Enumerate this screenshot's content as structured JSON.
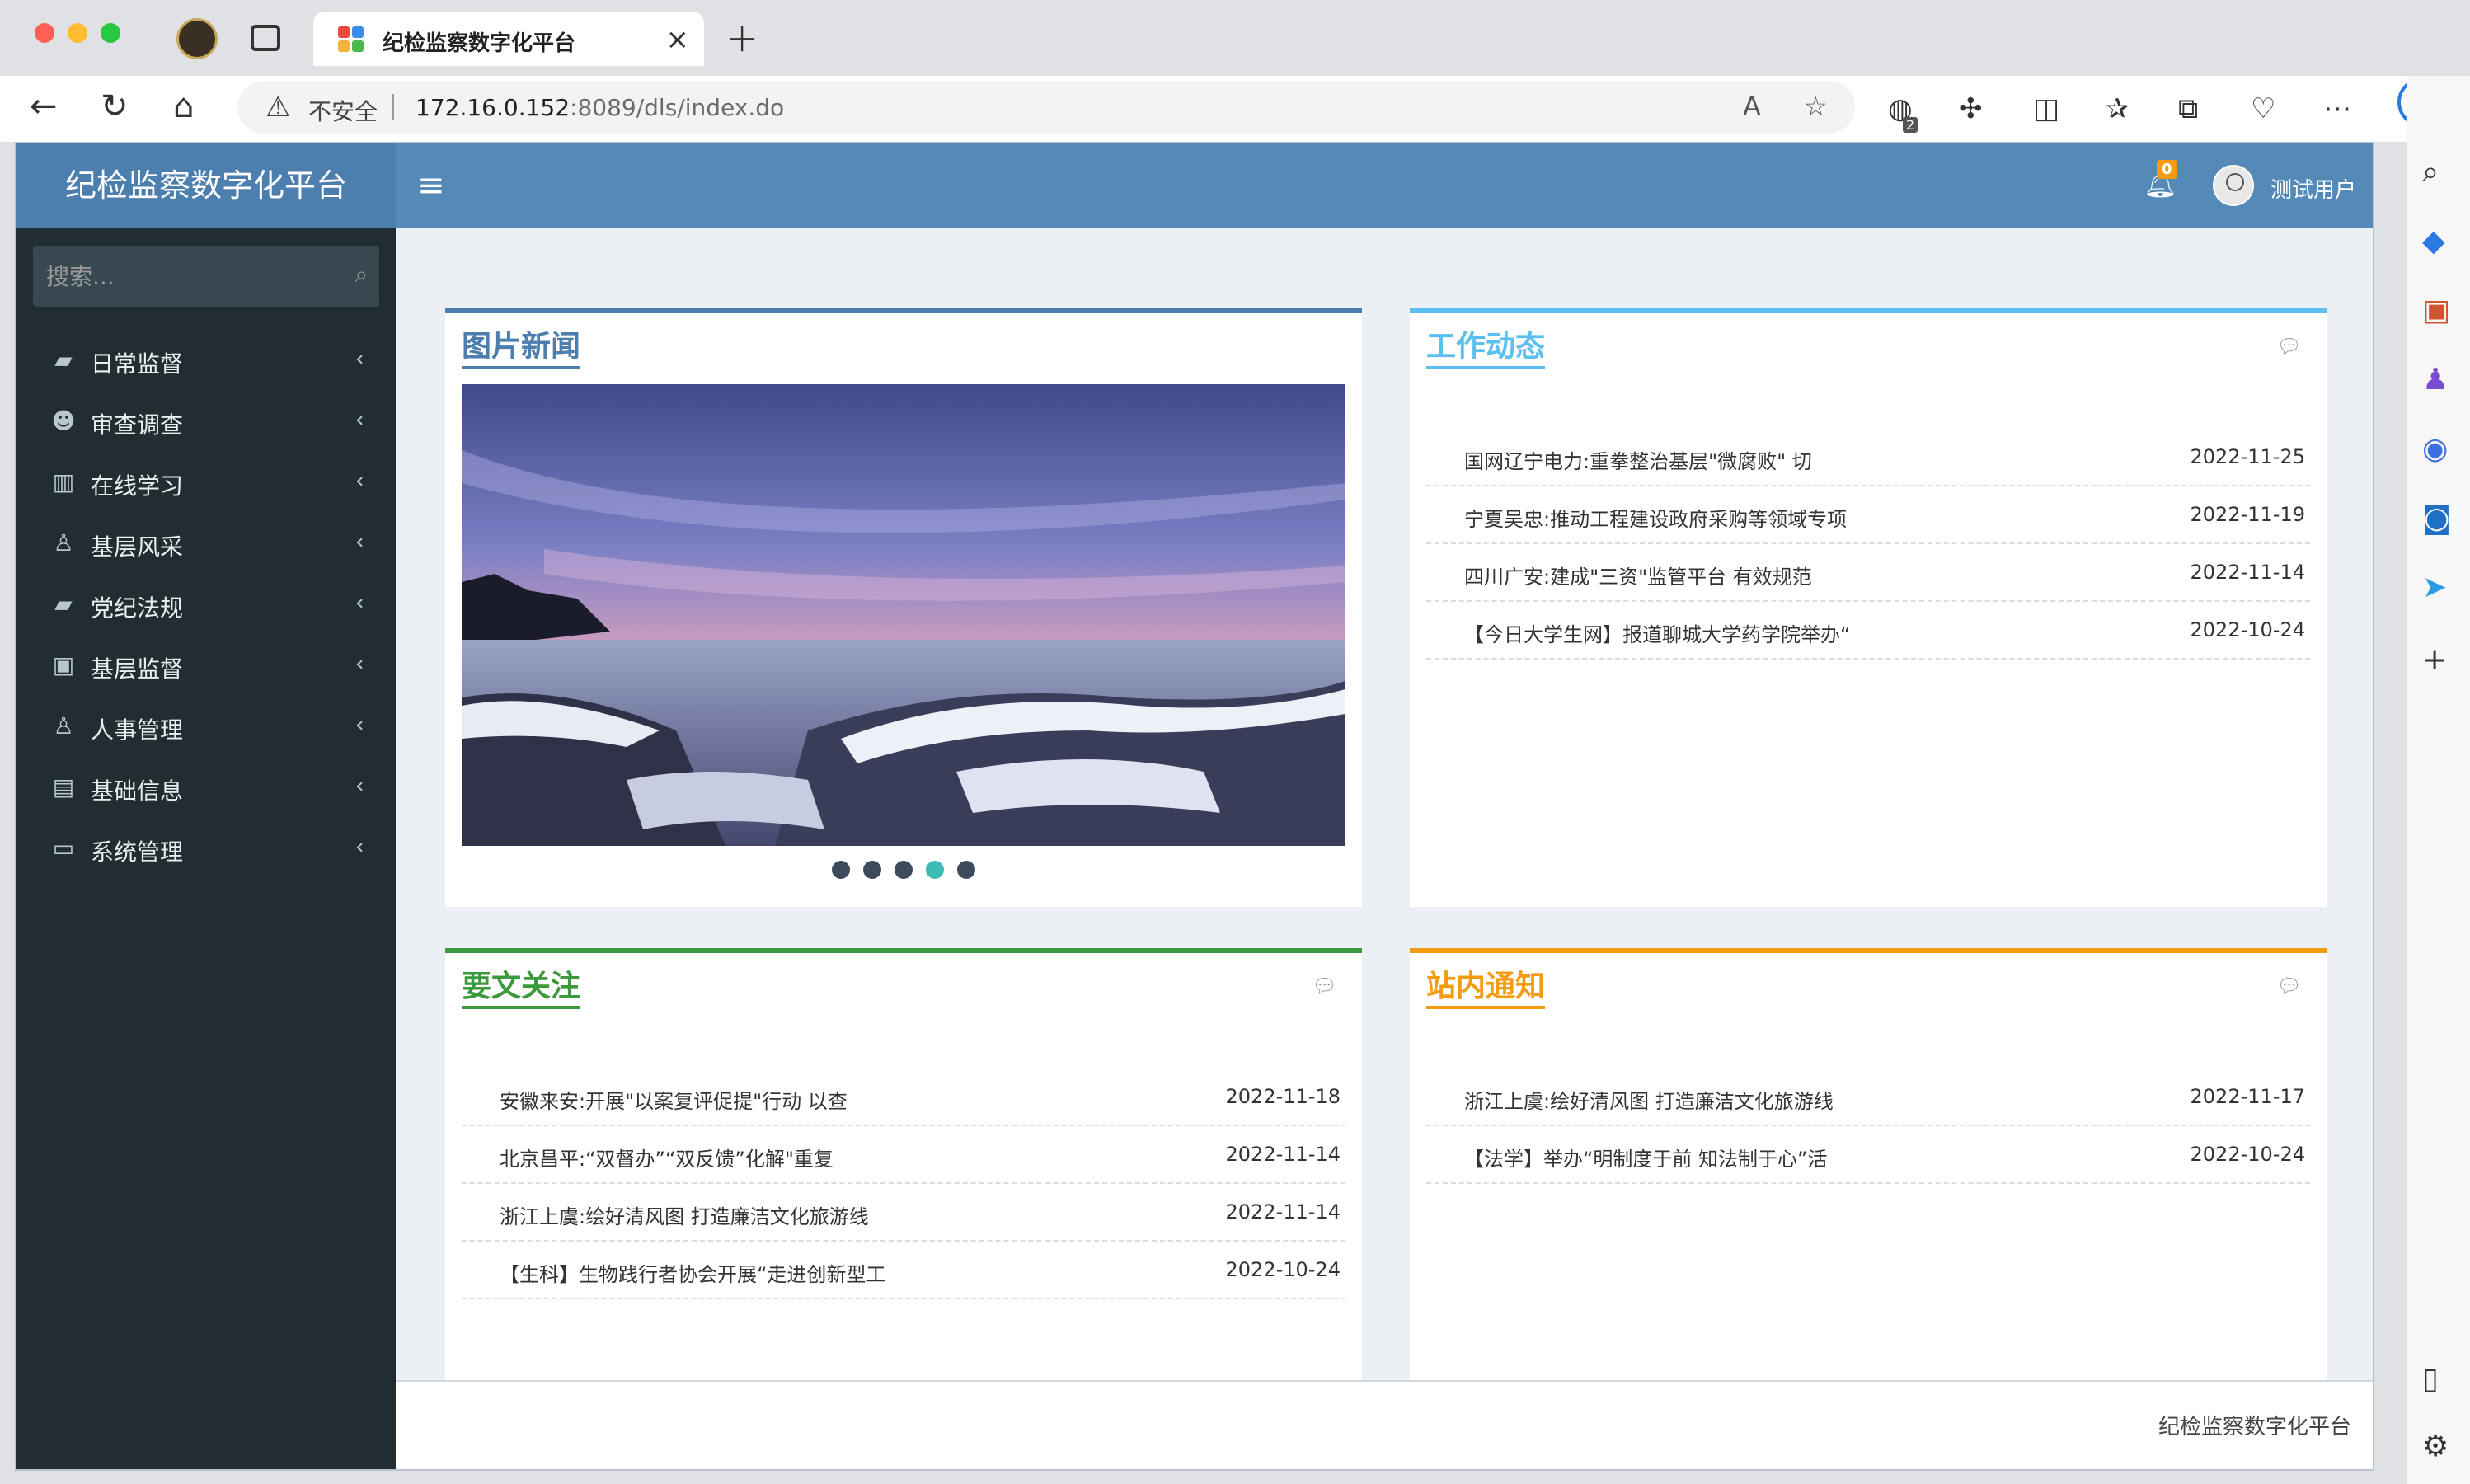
{
  "browser": {
    "tab_title": "纪检监察数字化平台",
    "security_label": "不安全",
    "url_host": "172.16.0.152",
    "url_rest": ":8089/dls/index.do",
    "extension_badge": "2"
  },
  "app": {
    "logo": "纪检监察数字化平台",
    "notification_count": "0",
    "username": "测试用户",
    "search_placeholder": "搜索...",
    "footer": "纪检监察数字化平台"
  },
  "sidebar": {
    "items": [
      {
        "label": "日常监督",
        "icon": "book-icon"
      },
      {
        "label": "审查调查",
        "icon": "users-icon"
      },
      {
        "label": "在线学习",
        "icon": "building-icon"
      },
      {
        "label": "基层风采",
        "icon": "person-icon"
      },
      {
        "label": "党纪法规",
        "icon": "book-icon"
      },
      {
        "label": "基层监督",
        "icon": "contact-book-icon"
      },
      {
        "label": "人事管理",
        "icon": "person-icon"
      },
      {
        "label": "基础信息",
        "icon": "file-icon"
      },
      {
        "label": "系统管理",
        "icon": "desktop-icon"
      }
    ]
  },
  "panels": {
    "photo_news": {
      "title": "图片新闻",
      "slide_count": 5,
      "active_slide": 3,
      "color": "#4d7fae"
    },
    "work_news": {
      "title": "工作动态",
      "color": "#5bc0ef",
      "items": [
        {
          "title": "国网辽宁电力:重拳整治基层\"微腐败\" 切",
          "date": "2022-11-25"
        },
        {
          "title": "宁夏吴忠:推动工程建设政府采购等领域专项",
          "date": "2022-11-19"
        },
        {
          "title": "四川广安:建成\"三资\"监管平台 有效规范",
          "date": "2022-11-14"
        },
        {
          "title": "【今日大学生网】报道聊城大学药学院举办“",
          "date": "2022-10-24"
        }
      ]
    },
    "key_articles": {
      "title": "要文关注",
      "color": "#3c9a3c",
      "items": [
        {
          "title": "安徽来安:开展\"以案复评促提\"行动 以查",
          "date": "2022-11-18"
        },
        {
          "title": "北京昌平:“双督办”“双反馈”化解\"重复",
          "date": "2022-11-14"
        },
        {
          "title": "浙江上虞:绘好清风图 打造廉洁文化旅游线",
          "date": "2022-11-14"
        },
        {
          "title": "【生科】生物践行者协会开展“走进创新型工",
          "date": "2022-10-24"
        }
      ]
    },
    "site_notices": {
      "title": "站内通知",
      "color": "#f39c12",
      "items": [
        {
          "title": "浙江上虞:绘好清风图 打造廉洁文化旅游线",
          "date": "2022-11-17"
        },
        {
          "title": "【法学】举办“明制度于前 知法制于心”活",
          "date": "2022-10-24"
        }
      ]
    }
  }
}
